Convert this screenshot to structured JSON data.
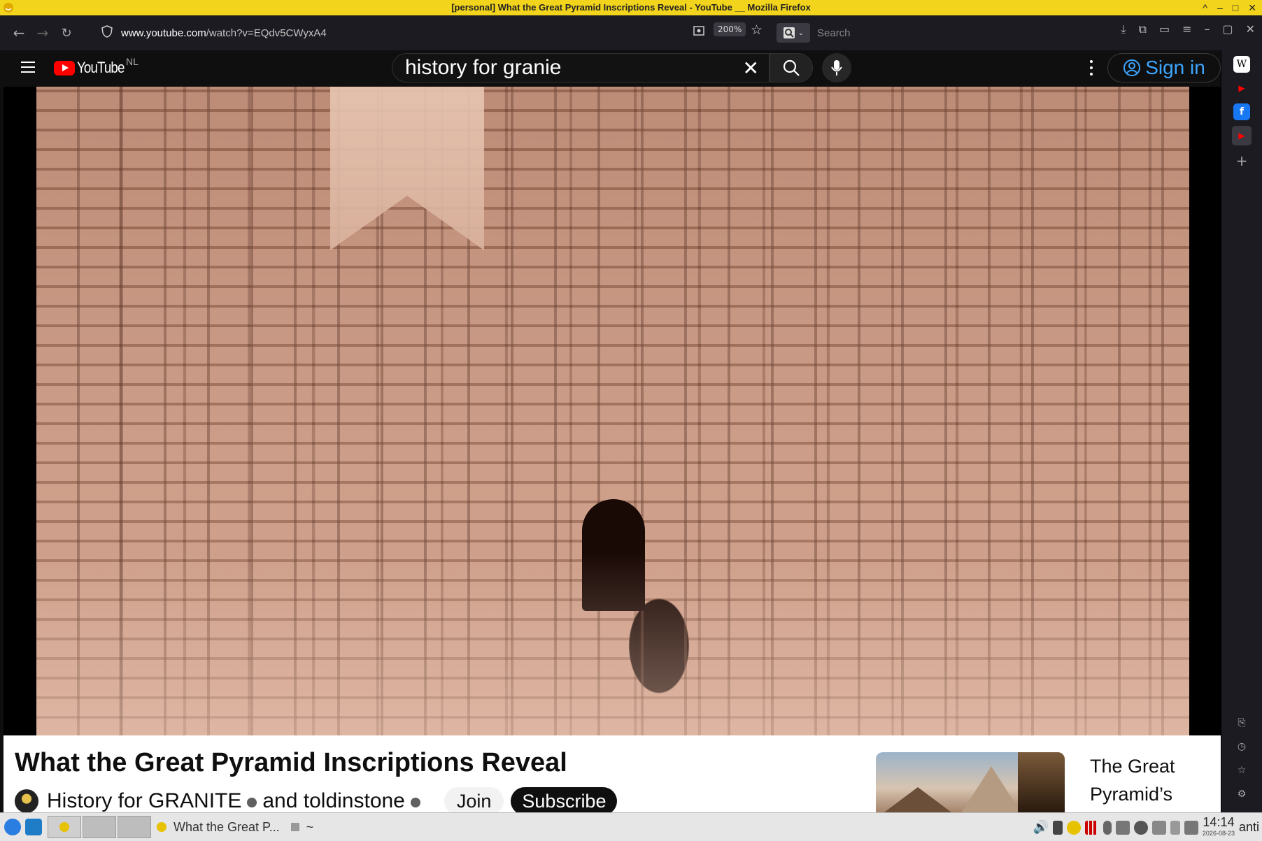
{
  "window": {
    "title": "[personal] What the Great Pyramid Inscriptions Reveal - YouTube __ Mozilla Firefox",
    "controls": [
      "^",
      "–",
      "□",
      "✕"
    ]
  },
  "browser": {
    "url_domain": "www.youtube.com",
    "url_path": "/watch?v=EQdv5CWyxA4",
    "zoom": "200%",
    "search_placeholder": "Search"
  },
  "youtube": {
    "logo_text": "YouTube",
    "country": "NL",
    "search_value": "history for granie",
    "sign_in": "Sign in",
    "video": {
      "title": "What the Great Pyramid Inscriptions Reveal"
    },
    "channel": {
      "name_part1": "History for GRANITE",
      "name_part2": "and toldinstone",
      "join": "Join",
      "subscribe": "Subscribe"
    },
    "recommended": {
      "title": "The Great Pyramid’s"
    }
  },
  "sidebar": {
    "items": [
      "W",
      "▶",
      "f",
      "▶",
      "+"
    ]
  },
  "taskbar": {
    "task_label": "What the Great P...",
    "terminal_label": "~",
    "clock_time": "14:14",
    "clock_date": "2026-08-23",
    "user": "anti"
  },
  "colors": {
    "titlebar": "#f2d41c",
    "browser_chrome": "#1c1b22",
    "youtube_red": "#ff0000",
    "sign_in_blue": "#3ea6ff"
  }
}
